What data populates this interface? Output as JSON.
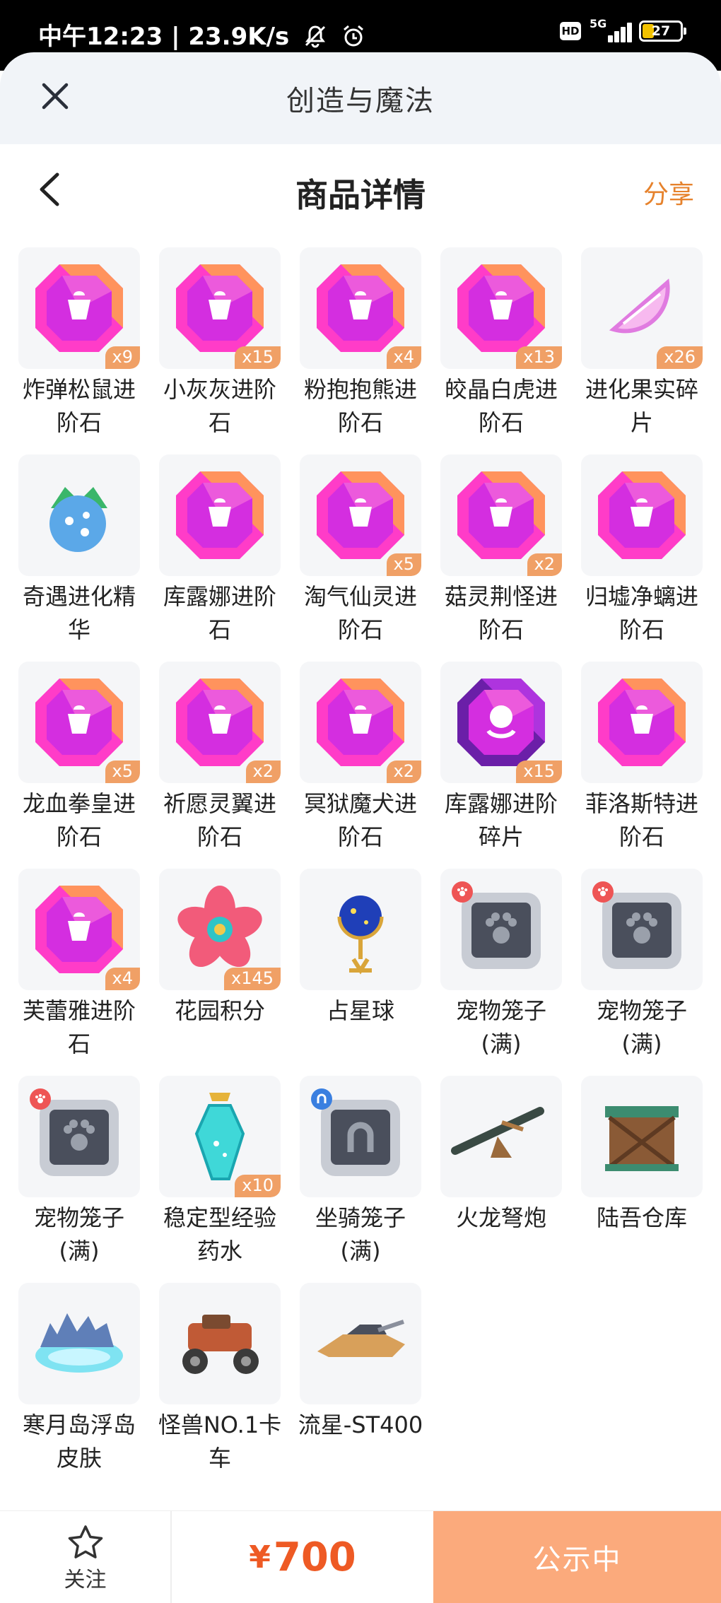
{
  "status_bar": {
    "time": "中午12:23",
    "speed": "23.9K/s",
    "hd": "HD",
    "network": "5G",
    "battery": "27"
  },
  "sheet": {
    "title": "创造与魔法"
  },
  "nav": {
    "title": "商品详情",
    "share": "分享"
  },
  "items": [
    {
      "name": "炸弹松鼠进阶石",
      "qty": "x9",
      "icon": "acorn-gem-icon",
      "kind": "gem",
      "color": "#f06"
    },
    {
      "name": "小灰灰进阶石",
      "qty": "x15",
      "icon": "lollipop-gem-icon",
      "kind": "gem"
    },
    {
      "name": "粉抱抱熊进阶石",
      "qty": "x4",
      "icon": "egg-gem-icon",
      "kind": "gem"
    },
    {
      "name": "皎晶白虎进阶石",
      "qty": "x13",
      "icon": "claw-gem-icon",
      "kind": "gem"
    },
    {
      "name": "进化果实碎片",
      "qty": "x26",
      "icon": "fruit-slice-icon",
      "kind": "slice"
    },
    {
      "name": "奇遇进化精华",
      "qty": "",
      "icon": "essence-fruit-icon",
      "kind": "essence"
    },
    {
      "name": "库露娜进阶石",
      "qty": "",
      "icon": "octopus-gem-icon",
      "kind": "gem"
    },
    {
      "name": "淘气仙灵进阶石",
      "qty": "x5",
      "icon": "spirit-gem-icon",
      "kind": "gem"
    },
    {
      "name": "菇灵荆怪进阶石",
      "qty": "x2",
      "icon": "mushroom-gem-icon",
      "kind": "gem"
    },
    {
      "name": "归墟净螭进阶石",
      "qty": "",
      "icon": "dragon-gem-icon",
      "kind": "gem"
    },
    {
      "name": "龙血拳皇进阶石",
      "qty": "x5",
      "icon": "bull-gem-icon",
      "kind": "gem"
    },
    {
      "name": "祈愿灵翼进阶石",
      "qty": "x2",
      "icon": "wing-gem-icon",
      "kind": "gem"
    },
    {
      "name": "冥狱魔犬进阶石",
      "qty": "x2",
      "icon": "serpent-gem-icon",
      "kind": "gem"
    },
    {
      "name": "库露娜进阶碎片",
      "qty": "x15",
      "icon": "octopus-shard-icon",
      "kind": "shard"
    },
    {
      "name": "菲洛斯特进阶石",
      "qty": "",
      "icon": "feather-gem-icon",
      "kind": "gem"
    },
    {
      "name": "芙蕾雅进阶石",
      "qty": "x4",
      "icon": "horns-gem-icon",
      "kind": "gem"
    },
    {
      "name": "花园积分",
      "qty": "x145",
      "icon": "flower-icon",
      "kind": "flower"
    },
    {
      "name": "占星球",
      "qty": "",
      "icon": "astrology-globe-icon",
      "kind": "globe"
    },
    {
      "name": "宠物笼子(满)",
      "qty": "",
      "icon": "pet-cage-icon",
      "kind": "cage"
    },
    {
      "name": "宠物笼子(满)",
      "qty": "",
      "icon": "pet-cage-icon",
      "kind": "cage"
    },
    {
      "name": "宠物笼子(满)",
      "qty": "",
      "icon": "pet-cage-icon",
      "kind": "cage"
    },
    {
      "name": "稳定型经验药水",
      "qty": "x10",
      "icon": "potion-icon",
      "kind": "potion"
    },
    {
      "name": "坐骑笼子(满)",
      "qty": "",
      "icon": "mount-cage-icon",
      "kind": "mountcage"
    },
    {
      "name": "火龙弩炮",
      "qty": "",
      "icon": "ballista-icon",
      "kind": "ballista"
    },
    {
      "name": "陆吾仓库",
      "qty": "",
      "icon": "warehouse-icon",
      "kind": "warehouse"
    },
    {
      "name": "寒月岛浮岛皮肤",
      "qty": "",
      "icon": "floating-island-icon",
      "kind": "island"
    },
    {
      "name": "怪兽NO.1卡车",
      "qty": "",
      "icon": "monster-truck-icon",
      "kind": "truck"
    },
    {
      "name": "流星-ST400",
      "qty": "",
      "icon": "hover-vehicle-icon",
      "kind": "vehicle"
    }
  ],
  "bottom": {
    "follow_label": "关注",
    "currency": "¥",
    "price": "700",
    "status_label": "公示中"
  }
}
